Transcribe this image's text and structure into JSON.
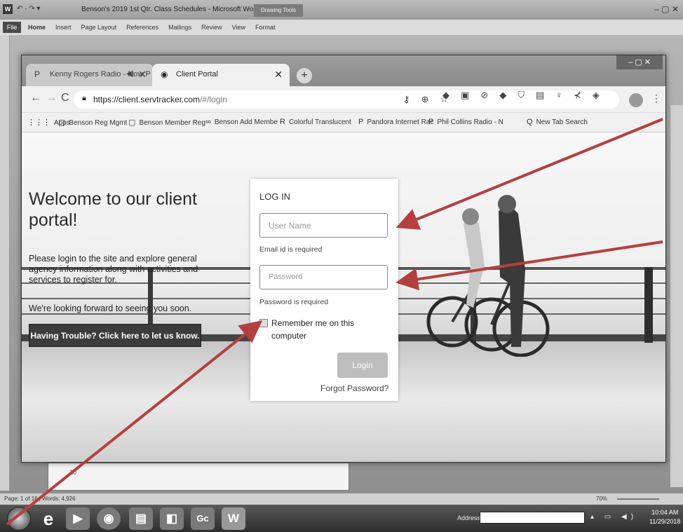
{
  "word": {
    "title": "Benson's 2019 1st Qtr. Class Schedules - Microsoft Word",
    "drawing_tools": "Drawing Tools",
    "ribbon_file": "File",
    "ribbon_tabs": [
      "Home",
      "Insert",
      "Page Layout",
      "References",
      "Mailings",
      "Review",
      "View",
      "Format"
    ],
    "status_left": "Page: 1 of 16  |  Words: 4,926",
    "zoom": "70%",
    "page_marker": "10"
  },
  "browser": {
    "tabs": [
      {
        "label": "Kenny Rogers Radio - Now P"
      },
      {
        "label": "Client Portal"
      }
    ],
    "new_tab": "+",
    "url_host": "https://client.servtracker.com",
    "url_path": "/#/login",
    "bookmarks": [
      {
        "icon": "⋮⋮⋮",
        "label": "Apps"
      },
      {
        "icon": "▢",
        "label": "Benson Reg Mgmt"
      },
      {
        "icon": "▢",
        "label": "Benson Member Reg"
      },
      {
        "icon": "∞",
        "label": "Benson Add Membe"
      },
      {
        "icon": "R",
        "label": "Colorful Translucent"
      },
      {
        "icon": "P",
        "label": "Pandora Internet Rac"
      },
      {
        "icon": "P",
        "label": "Phil Collins Radio - N"
      },
      {
        "icon": "Q",
        "label": "New Tab Search"
      }
    ]
  },
  "page": {
    "welcome_title": "Welcome to our client portal!",
    "welcome_body": "Please login to the site and explore general agency information along with activities and services to register for.",
    "welcome_soon": "We're looking forward to seeing you soon.",
    "trouble_button": "Having Trouble? Click here to let us know."
  },
  "login": {
    "heading": "LOG IN",
    "username_placeholder": "User Name",
    "email_error": "Email id is required",
    "password_placeholder": "Password",
    "password_error": "Password is required",
    "remember_label": "Remember me on this computer",
    "login_button": "Login",
    "forgot_link": "Forgot Password?"
  },
  "taskbar": {
    "address_label": "Address",
    "time": "10:04 AM",
    "date": "11/29/2018"
  },
  "colors": {
    "annotation_arrow": "#b3403f"
  }
}
